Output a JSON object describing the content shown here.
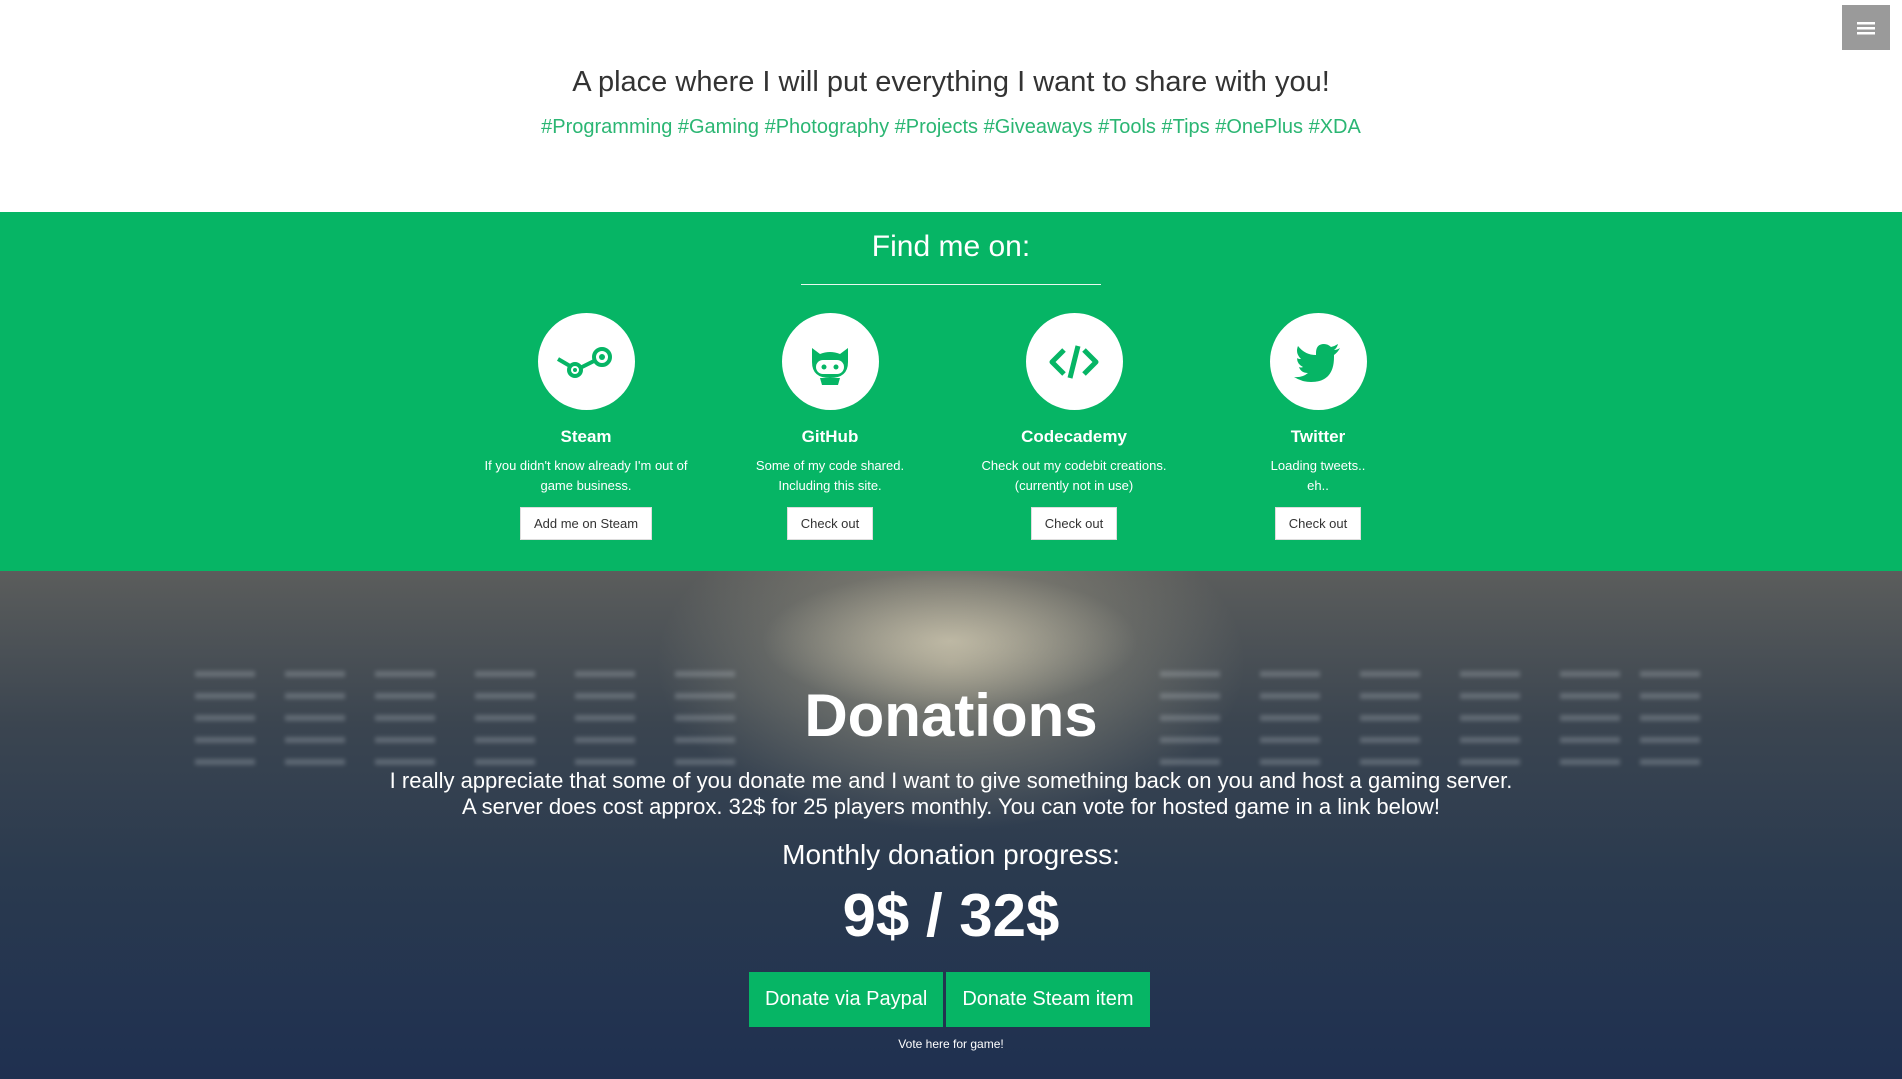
{
  "header": {
    "tagline": "A place where I will put everything I want to share with you!",
    "hashtags": "#Programming #Gaming #Photography #Projects #Giveaways #Tools #Tips #OnePlus #XDA"
  },
  "menu": {
    "icon": "hamburger-menu-icon"
  },
  "find": {
    "title": "Find me on:",
    "cards": [
      {
        "name": "Steam",
        "icon": "steam-icon",
        "desc1": "If you didn't know already I'm out of",
        "desc2": "game business.",
        "button": "Add me on Steam"
      },
      {
        "name": "GitHub",
        "icon": "github-icon",
        "desc1": "Some of my code shared.",
        "desc2": "Including this site.",
        "button": "Check out"
      },
      {
        "name": "Codecademy",
        "icon": "code-icon",
        "desc1": "Check out my codebit creations.",
        "desc2": "(currently not in use)",
        "button": "Check out"
      },
      {
        "name": "Twitter",
        "icon": "twitter-bird-icon",
        "desc1": "Loading tweets..",
        "desc2": "eh..",
        "button": "Check out"
      }
    ]
  },
  "donations": {
    "title": "Donations",
    "line1": "I really appreciate that some of you donate me and I want to give something back on you and host a gaming server.",
    "line2": "A server does cost approx. 32$ for 25 players monthly. You can vote for hosted game in a link below!",
    "progress_label": "Monthly donation progress:",
    "progress_value": "9$ / 32$",
    "paypal_button": "Donate via Paypal",
    "steam_button": "Donate Steam item",
    "vote_link": "Vote here for game!"
  },
  "colors": {
    "accent": "#06b565",
    "hashtag": "#2bb673"
  }
}
